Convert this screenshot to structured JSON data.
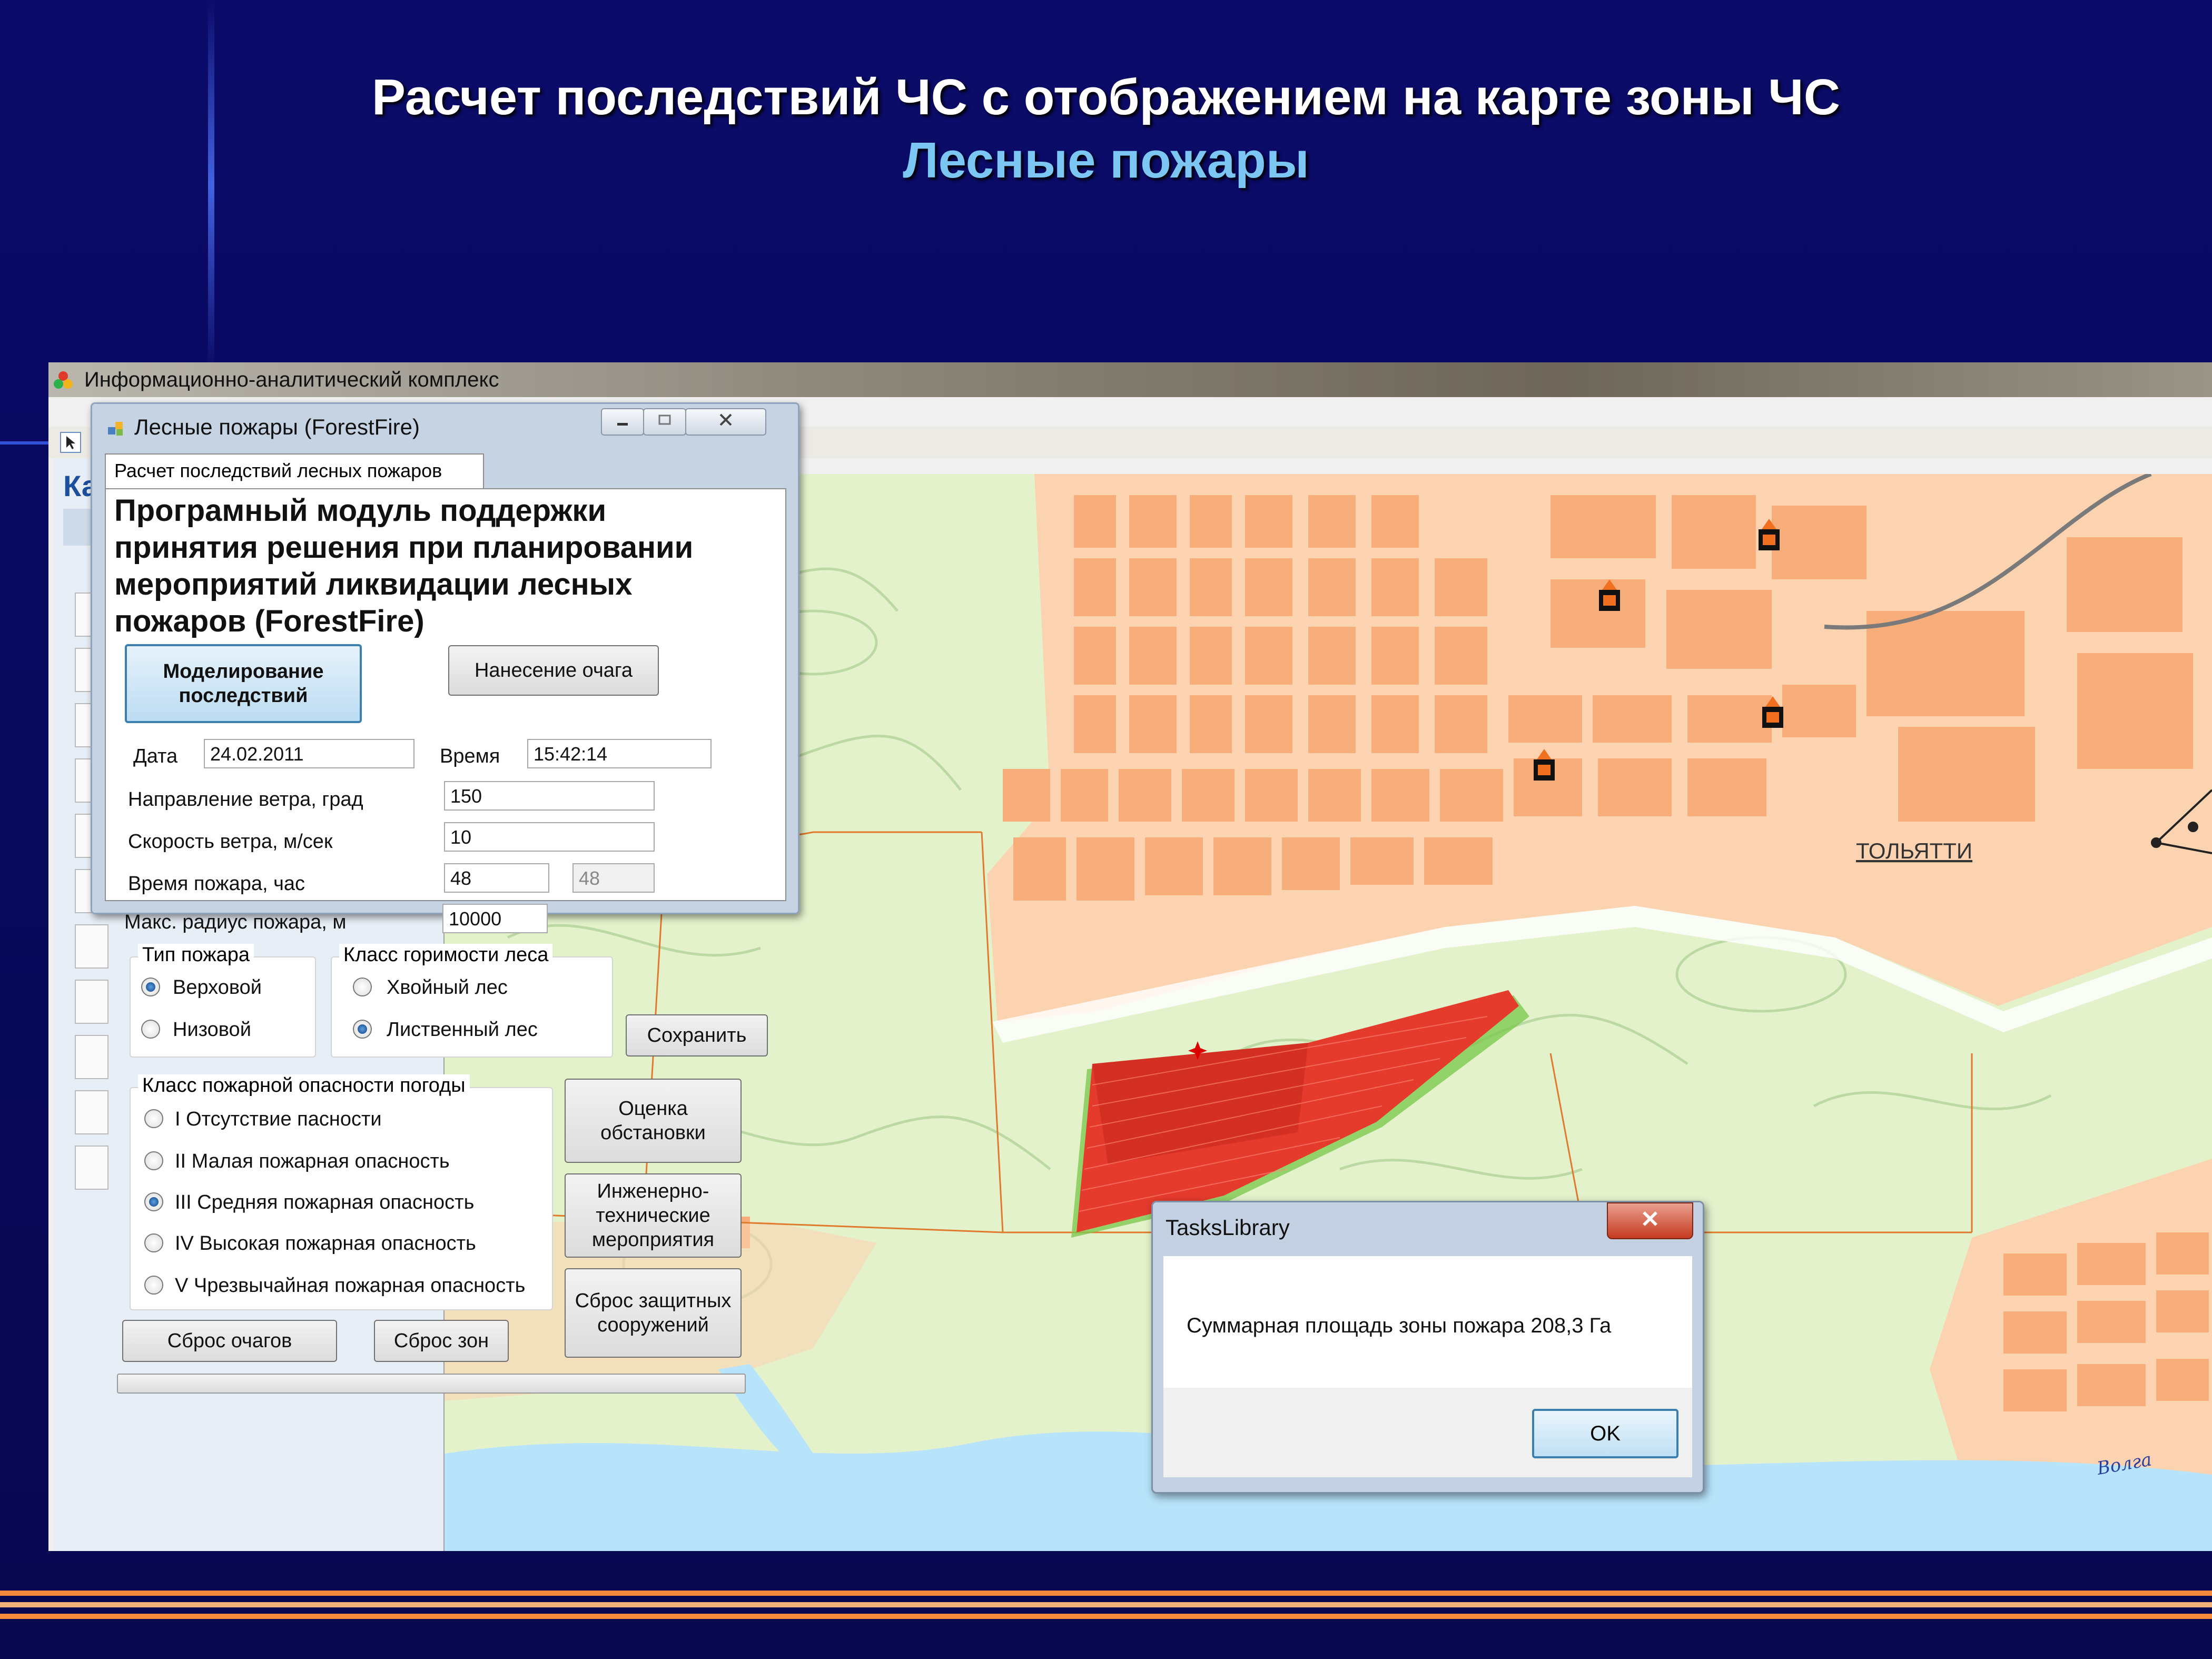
{
  "slide": {
    "title_line1": "Расчет последствий  ЧС с отображением на карте зоны ЧС",
    "title_line2": "Лесные пожары"
  },
  "app": {
    "window_title": "Информационно-аналитический комплекс",
    "left_panel_title": "Ка"
  },
  "map": {
    "city_label": "ТОЛЬЯТТИ",
    "river_label": "Волга",
    "colors": {
      "forest": "#e4f2cc",
      "urban": "#fbd3b0",
      "block": "#f6ad7a",
      "water": "#b8e4fb",
      "fire": "#e53b2c"
    }
  },
  "forest_fire_dialog": {
    "title": "Лесные пожары (ForestFire)",
    "tab_label": "Расчет последствий лесных пожаров",
    "heading": "Програмный модуль поддержки принятия решения при планировании мероприятий ликвидации лесных пожаров (ForestFire)",
    "btn_modeling": "Моделирование последствий",
    "btn_focus": "Нанесение очага",
    "date_label": "Дата",
    "date_value": "24.02.2011",
    "time_label": "Время",
    "time_value": "15:42:14",
    "wind_dir_label": "Направление ветра, град",
    "wind_dir_value": "150",
    "wind_speed_label": "Скорость ветра, м/сек",
    "wind_speed_value": "10",
    "fire_time_label": "Время пожара, час",
    "fire_time_value": "48",
    "fire_time_value2": "48",
    "max_radius_label": "Макс.  радиус пожара, м",
    "max_radius_value": "10000",
    "fire_type_group": "Тип пожара",
    "fire_type_options": [
      "Верховой",
      "Низовой"
    ],
    "forest_class_group": "Класс горимости леса",
    "forest_class_options": [
      "Хвойный лес",
      "Лиственный лес"
    ],
    "btn_save": "Сохранить",
    "weather_group": "Класс пожарной опасности погоды",
    "weather_options": [
      "I Отсутствие пасности",
      "II Малая пожарная опасность",
      "III Средняя пожарная опасность",
      "IV Высокая пожарная опасность",
      "V Чрезвычайная пожарная опасность"
    ],
    "btn_assess": "Оценка обстановки",
    "btn_engineering": "Инженерно-технические мероприятия",
    "btn_reset_protect": "Сброс защитных сооружений",
    "btn_reset_foci": "Сброс очагов",
    "btn_reset_zones": "Сброс зон"
  },
  "message_box": {
    "title": "TasksLibrary",
    "text": "Суммарная площадь зоны пожара 208,3 Га",
    "ok_label": "OK",
    "close_glyph": "✕"
  }
}
